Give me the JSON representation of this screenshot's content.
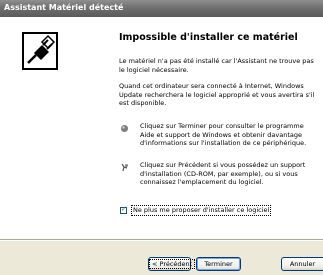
{
  "window": {
    "title": "Assistant Matériel détecté"
  },
  "main": {
    "heading": "Impossible d'installer ce matériel",
    "paragraph1": "Le matériel n'a pas été installé car l'Assistant ne trouve pas le logiciel nécessaire.",
    "paragraph2": "Quand cet ordinateur sera connecté à Internet, Windows Update recherchera le logiciel approprié et vous avertira s'il est disponible.",
    "info1": "Cliquez sur Terminer pour consulter le programme Aide et support de Windows et obtenir davantage d'informations sur l'installation de ce périphérique.",
    "info2": "Cliquez sur Précédent si vous possédez un support d'installation (CD-ROM, par exemple), ou si vous connaissez l'emplacement du logiciel.",
    "checkbox_label": "Ne plus me proposer d'installer ce logiciel",
    "checkbox_checked": true
  },
  "buttons": {
    "back_prefix": "< ",
    "back_label": "Précédent",
    "finish_label": "Terminer",
    "cancel_label": "Annuler"
  },
  "icons": {
    "wizard": "hardware-connector-icon",
    "info1": "help-bullet-icon",
    "info2": "hardware-bullet-icon"
  }
}
